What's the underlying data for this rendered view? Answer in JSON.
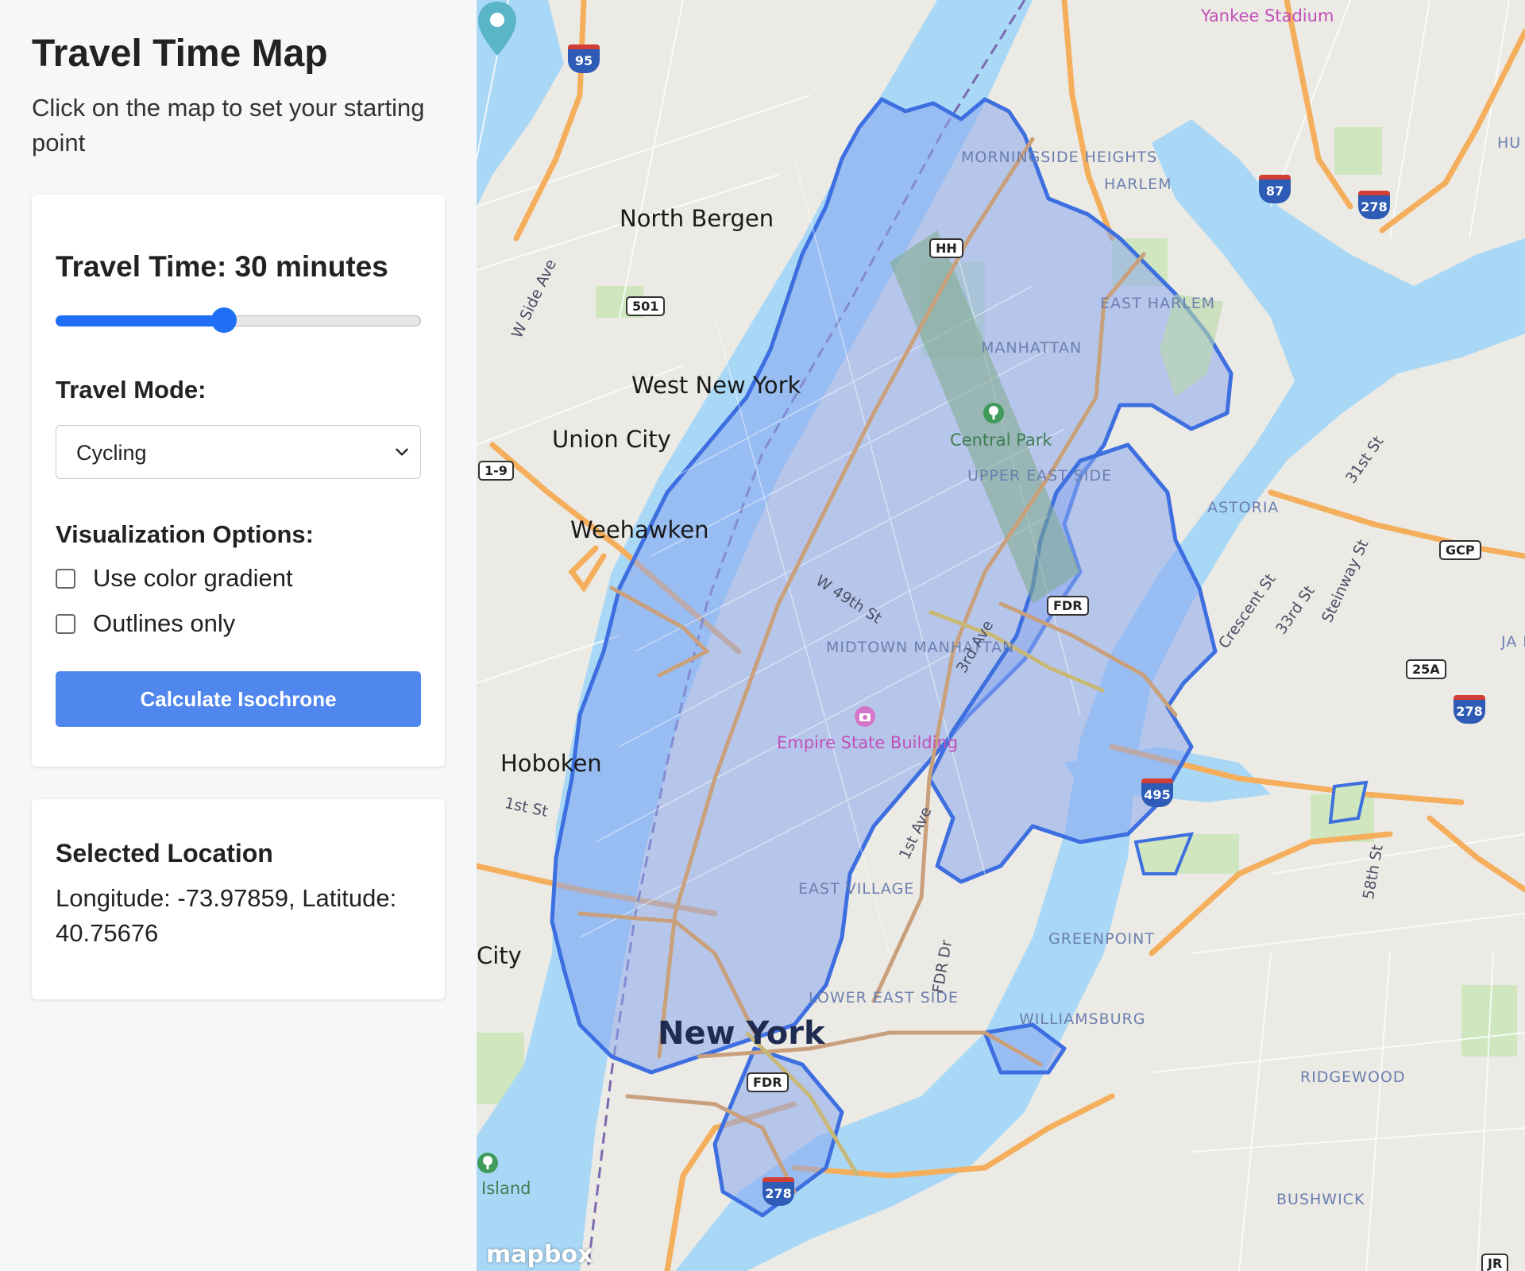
{
  "sidebar": {
    "title": "Travel Time Map",
    "subtitle": "Click on the map to set your starting point",
    "travel_time": {
      "prefix": "Travel Time: ",
      "value_text": "30 minutes",
      "slider_fraction": 0.46
    },
    "travel_mode": {
      "label": "Travel Mode:",
      "selected": "Cycling"
    },
    "visualization": {
      "label": "Visualization Options:",
      "options": [
        {
          "label": "Use color gradient",
          "checked": false
        },
        {
          "label": "Outlines only",
          "checked": false
        }
      ]
    },
    "calculate_button": "Calculate Isochrone",
    "location": {
      "title": "Selected Location",
      "text": "Longitude: -73.97859, Latitude: 40.75676"
    },
    "accent_color": "#1f6ef5",
    "button_color": "#4f87ee"
  },
  "map": {
    "isochrone_fill": "#8aa8ee",
    "isochrone_stroke": "#3d6fe0",
    "water_color": "#a9d8f7",
    "labels": {
      "yankee_stadium": "Yankee Stadium",
      "morningside_heights": "MORNINGSIDE HEIGHTS",
      "harlem": "HARLEM",
      "north_bergen": "North Bergen",
      "east_harlem": "EAST HARLEM",
      "manhattan": "MANHATTAN",
      "w_side_ave": "W Side Ave",
      "west_new_york": "West New York",
      "union_city": "Union City",
      "central_park": "Central Park",
      "upper_east_side": "UPPER EAST SIDE",
      "astoria": "ASTORIA",
      "st_31": "31st St",
      "weehawken": "Weehawken",
      "w_49th_st": "W 49th St",
      "midtown_manhattan": "MIDTOWN MANHATTAN",
      "third_ave": "3rd Ave",
      "crescent_st": "Crescent St",
      "st_33": "33rd St",
      "steinway_st": "Steinway St",
      "empire_state_building": "Empire State Building",
      "hoboken": "Hoboken",
      "first_st": "1st St",
      "first_ave": "1st Ave",
      "east_village": "EAST VILLAGE",
      "greenpoint": "GREENPOINT",
      "fdr_dr": "FDR Dr",
      "city_partial": "City",
      "new_york": "New York",
      "lower_east_side": "LOWER EAST SIDE",
      "williamsburg": "WILLIAMSBURG",
      "ridgewood": "RIDGEWOOD",
      "st_58": "58th St",
      "island_partial": "Island",
      "bushwick": "BUSHWICK",
      "hu_partial": "HU",
      "ja_partial": "JA HE"
    },
    "shields": {
      "i95": "95",
      "i87": "87",
      "i278_top": "278",
      "hh": "HH",
      "r501": "501",
      "us19": "1-9",
      "gcp": "GCP",
      "fdr_mid": "FDR",
      "r25a": "25A",
      "i278_right": "278",
      "i495": "495",
      "fdr_low": "FDR",
      "i278_bottom": "278",
      "jr": "JR"
    },
    "attribution": "mapbox"
  }
}
